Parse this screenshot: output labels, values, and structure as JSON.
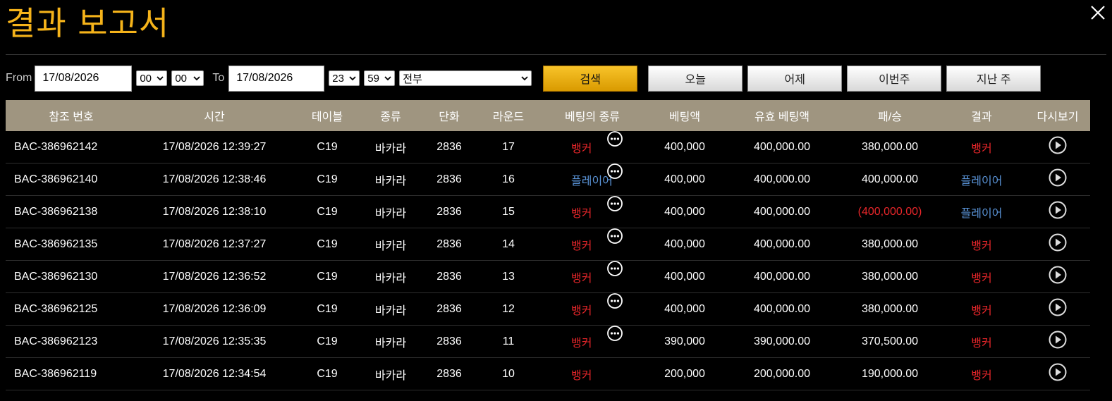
{
  "title": "결과 보고서",
  "filter": {
    "from_label": "From",
    "from_date": "17/08/2026",
    "from_hour": "00",
    "from_min": "00",
    "to_label": "To",
    "to_date": "17/08/2026",
    "to_hour": "23",
    "to_min": "59",
    "type_select": "전부",
    "search_label": "검색",
    "today_label": "오늘",
    "yesterday_label": "어제",
    "this_week_label": "이번주",
    "last_week_label": "지난 주"
  },
  "table": {
    "headers": [
      "참조 번호",
      "시간",
      "테이블",
      "종류",
      "단화",
      "라운드",
      "베팅의 종류",
      "베팅액",
      "유효 베팅액",
      "패/승",
      "결과",
      "다시보기"
    ],
    "rows": [
      {
        "ref": "BAC-386962142",
        "time": "17/08/2026 12:39:27",
        "table": "C19",
        "game": "바카라",
        "shoe": "2836",
        "round": "17",
        "bet_type": "뱅커",
        "bet_class": "banker",
        "more": true,
        "bet": "400,000",
        "valid_bet": "400,000.00",
        "win_loss": "380,000.00",
        "neg": false,
        "result": "뱅커",
        "result_class": "banker"
      },
      {
        "ref": "BAC-386962140",
        "time": "17/08/2026 12:38:46",
        "table": "C19",
        "game": "바카라",
        "shoe": "2836",
        "round": "16",
        "bet_type": "플레이어",
        "bet_class": "player",
        "more": true,
        "bet": "400,000",
        "valid_bet": "400,000.00",
        "win_loss": "400,000.00",
        "neg": false,
        "result": "플레이어",
        "result_class": "player"
      },
      {
        "ref": "BAC-386962138",
        "time": "17/08/2026 12:38:10",
        "table": "C19",
        "game": "바카라",
        "shoe": "2836",
        "round": "15",
        "bet_type": "뱅커",
        "bet_class": "banker",
        "more": true,
        "bet": "400,000",
        "valid_bet": "400,000.00",
        "win_loss": "(400,000.00)",
        "neg": true,
        "result": "플레이어",
        "result_class": "player"
      },
      {
        "ref": "BAC-386962135",
        "time": "17/08/2026 12:37:27",
        "table": "C19",
        "game": "바카라",
        "shoe": "2836",
        "round": "14",
        "bet_type": "뱅커",
        "bet_class": "banker",
        "more": true,
        "bet": "400,000",
        "valid_bet": "400,000.00",
        "win_loss": "380,000.00",
        "neg": false,
        "result": "뱅커",
        "result_class": "banker"
      },
      {
        "ref": "BAC-386962130",
        "time": "17/08/2026 12:36:52",
        "table": "C19",
        "game": "바카라",
        "shoe": "2836",
        "round": "13",
        "bet_type": "뱅커",
        "bet_class": "banker",
        "more": true,
        "bet": "400,000",
        "valid_bet": "400,000.00",
        "win_loss": "380,000.00",
        "neg": false,
        "result": "뱅커",
        "result_class": "banker"
      },
      {
        "ref": "BAC-386962125",
        "time": "17/08/2026 12:36:09",
        "table": "C19",
        "game": "바카라",
        "shoe": "2836",
        "round": "12",
        "bet_type": "뱅커",
        "bet_class": "banker",
        "more": true,
        "bet": "400,000",
        "valid_bet": "400,000.00",
        "win_loss": "380,000.00",
        "neg": false,
        "result": "뱅커",
        "result_class": "banker"
      },
      {
        "ref": "BAC-386962123",
        "time": "17/08/2026 12:35:35",
        "table": "C19",
        "game": "바카라",
        "shoe": "2836",
        "round": "11",
        "bet_type": "뱅커",
        "bet_class": "banker",
        "more": true,
        "bet": "390,000",
        "valid_bet": "390,000.00",
        "win_loss": "370,500.00",
        "neg": false,
        "result": "뱅커",
        "result_class": "banker"
      },
      {
        "ref": "BAC-386962119",
        "time": "17/08/2026 12:34:54",
        "table": "C19",
        "game": "바카라",
        "shoe": "2836",
        "round": "10",
        "bet_type": "뱅커",
        "bet_class": "banker",
        "more": false,
        "bet": "200,000",
        "valid_bet": "200,000.00",
        "win_loss": "190,000.00",
        "neg": false,
        "result": "뱅커",
        "result_class": "banker"
      }
    ]
  },
  "colors": {
    "title": "#f5b31a",
    "header_bg": "#9f9580",
    "banker": "#e8262a",
    "player": "#5a94d8",
    "search_btn": "#f8c42a"
  },
  "icons": {
    "close": "close-icon",
    "more": "more-options-icon",
    "replay": "play-circle-icon",
    "dropdown": "chevron-down-icon"
  }
}
